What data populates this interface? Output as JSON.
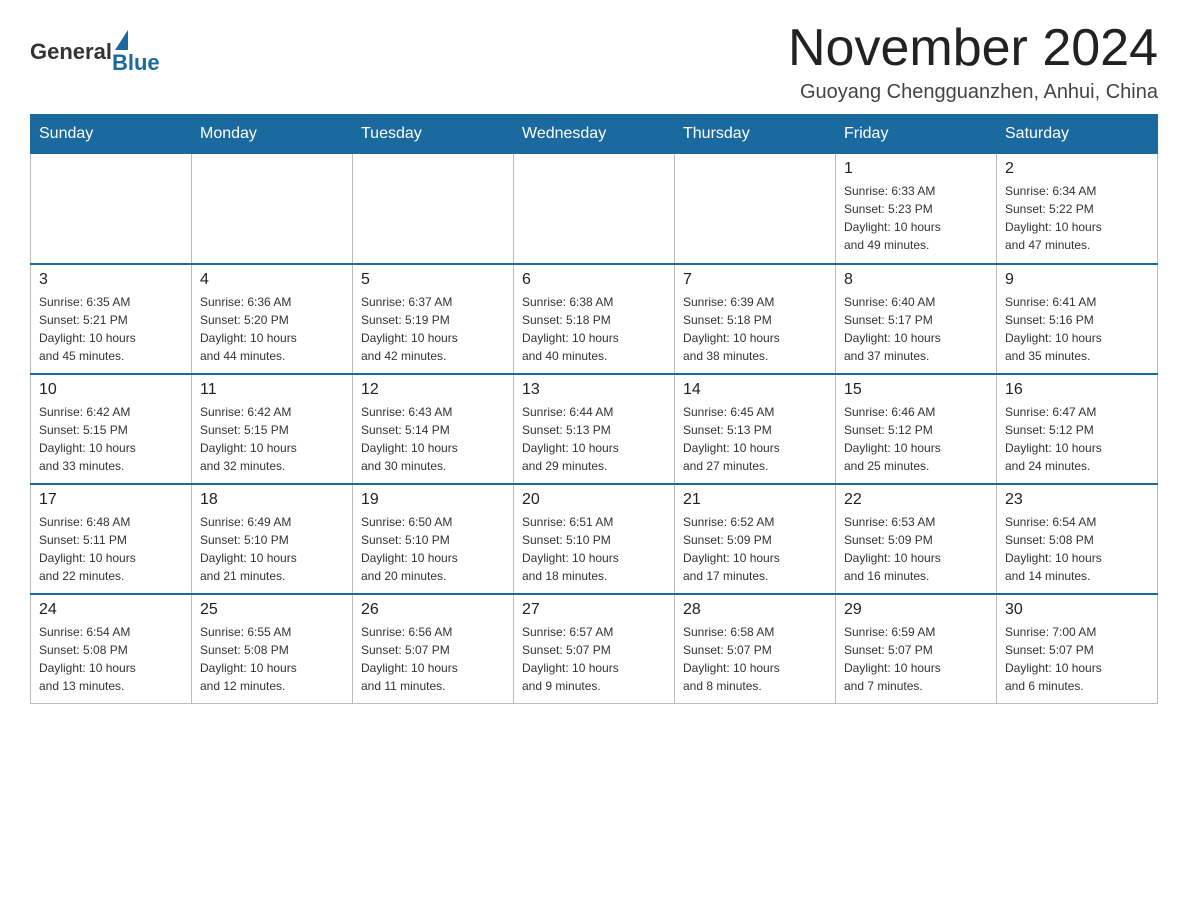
{
  "logo": {
    "general": "General",
    "blue": "Blue"
  },
  "title": "November 2024",
  "location": "Guoyang Chengguanzhen, Anhui, China",
  "weekdays": [
    "Sunday",
    "Monday",
    "Tuesday",
    "Wednesday",
    "Thursday",
    "Friday",
    "Saturday"
  ],
  "weeks": [
    [
      {
        "day": "",
        "info": ""
      },
      {
        "day": "",
        "info": ""
      },
      {
        "day": "",
        "info": ""
      },
      {
        "day": "",
        "info": ""
      },
      {
        "day": "",
        "info": ""
      },
      {
        "day": "1",
        "info": "Sunrise: 6:33 AM\nSunset: 5:23 PM\nDaylight: 10 hours\nand 49 minutes."
      },
      {
        "day": "2",
        "info": "Sunrise: 6:34 AM\nSunset: 5:22 PM\nDaylight: 10 hours\nand 47 minutes."
      }
    ],
    [
      {
        "day": "3",
        "info": "Sunrise: 6:35 AM\nSunset: 5:21 PM\nDaylight: 10 hours\nand 45 minutes."
      },
      {
        "day": "4",
        "info": "Sunrise: 6:36 AM\nSunset: 5:20 PM\nDaylight: 10 hours\nand 44 minutes."
      },
      {
        "day": "5",
        "info": "Sunrise: 6:37 AM\nSunset: 5:19 PM\nDaylight: 10 hours\nand 42 minutes."
      },
      {
        "day": "6",
        "info": "Sunrise: 6:38 AM\nSunset: 5:18 PM\nDaylight: 10 hours\nand 40 minutes."
      },
      {
        "day": "7",
        "info": "Sunrise: 6:39 AM\nSunset: 5:18 PM\nDaylight: 10 hours\nand 38 minutes."
      },
      {
        "day": "8",
        "info": "Sunrise: 6:40 AM\nSunset: 5:17 PM\nDaylight: 10 hours\nand 37 minutes."
      },
      {
        "day": "9",
        "info": "Sunrise: 6:41 AM\nSunset: 5:16 PM\nDaylight: 10 hours\nand 35 minutes."
      }
    ],
    [
      {
        "day": "10",
        "info": "Sunrise: 6:42 AM\nSunset: 5:15 PM\nDaylight: 10 hours\nand 33 minutes."
      },
      {
        "day": "11",
        "info": "Sunrise: 6:42 AM\nSunset: 5:15 PM\nDaylight: 10 hours\nand 32 minutes."
      },
      {
        "day": "12",
        "info": "Sunrise: 6:43 AM\nSunset: 5:14 PM\nDaylight: 10 hours\nand 30 minutes."
      },
      {
        "day": "13",
        "info": "Sunrise: 6:44 AM\nSunset: 5:13 PM\nDaylight: 10 hours\nand 29 minutes."
      },
      {
        "day": "14",
        "info": "Sunrise: 6:45 AM\nSunset: 5:13 PM\nDaylight: 10 hours\nand 27 minutes."
      },
      {
        "day": "15",
        "info": "Sunrise: 6:46 AM\nSunset: 5:12 PM\nDaylight: 10 hours\nand 25 minutes."
      },
      {
        "day": "16",
        "info": "Sunrise: 6:47 AM\nSunset: 5:12 PM\nDaylight: 10 hours\nand 24 minutes."
      }
    ],
    [
      {
        "day": "17",
        "info": "Sunrise: 6:48 AM\nSunset: 5:11 PM\nDaylight: 10 hours\nand 22 minutes."
      },
      {
        "day": "18",
        "info": "Sunrise: 6:49 AM\nSunset: 5:10 PM\nDaylight: 10 hours\nand 21 minutes."
      },
      {
        "day": "19",
        "info": "Sunrise: 6:50 AM\nSunset: 5:10 PM\nDaylight: 10 hours\nand 20 minutes."
      },
      {
        "day": "20",
        "info": "Sunrise: 6:51 AM\nSunset: 5:10 PM\nDaylight: 10 hours\nand 18 minutes."
      },
      {
        "day": "21",
        "info": "Sunrise: 6:52 AM\nSunset: 5:09 PM\nDaylight: 10 hours\nand 17 minutes."
      },
      {
        "day": "22",
        "info": "Sunrise: 6:53 AM\nSunset: 5:09 PM\nDaylight: 10 hours\nand 16 minutes."
      },
      {
        "day": "23",
        "info": "Sunrise: 6:54 AM\nSunset: 5:08 PM\nDaylight: 10 hours\nand 14 minutes."
      }
    ],
    [
      {
        "day": "24",
        "info": "Sunrise: 6:54 AM\nSunset: 5:08 PM\nDaylight: 10 hours\nand 13 minutes."
      },
      {
        "day": "25",
        "info": "Sunrise: 6:55 AM\nSunset: 5:08 PM\nDaylight: 10 hours\nand 12 minutes."
      },
      {
        "day": "26",
        "info": "Sunrise: 6:56 AM\nSunset: 5:07 PM\nDaylight: 10 hours\nand 11 minutes."
      },
      {
        "day": "27",
        "info": "Sunrise: 6:57 AM\nSunset: 5:07 PM\nDaylight: 10 hours\nand 9 minutes."
      },
      {
        "day": "28",
        "info": "Sunrise: 6:58 AM\nSunset: 5:07 PM\nDaylight: 10 hours\nand 8 minutes."
      },
      {
        "day": "29",
        "info": "Sunrise: 6:59 AM\nSunset: 5:07 PM\nDaylight: 10 hours\nand 7 minutes."
      },
      {
        "day": "30",
        "info": "Sunrise: 7:00 AM\nSunset: 5:07 PM\nDaylight: 10 hours\nand 6 minutes."
      }
    ]
  ]
}
